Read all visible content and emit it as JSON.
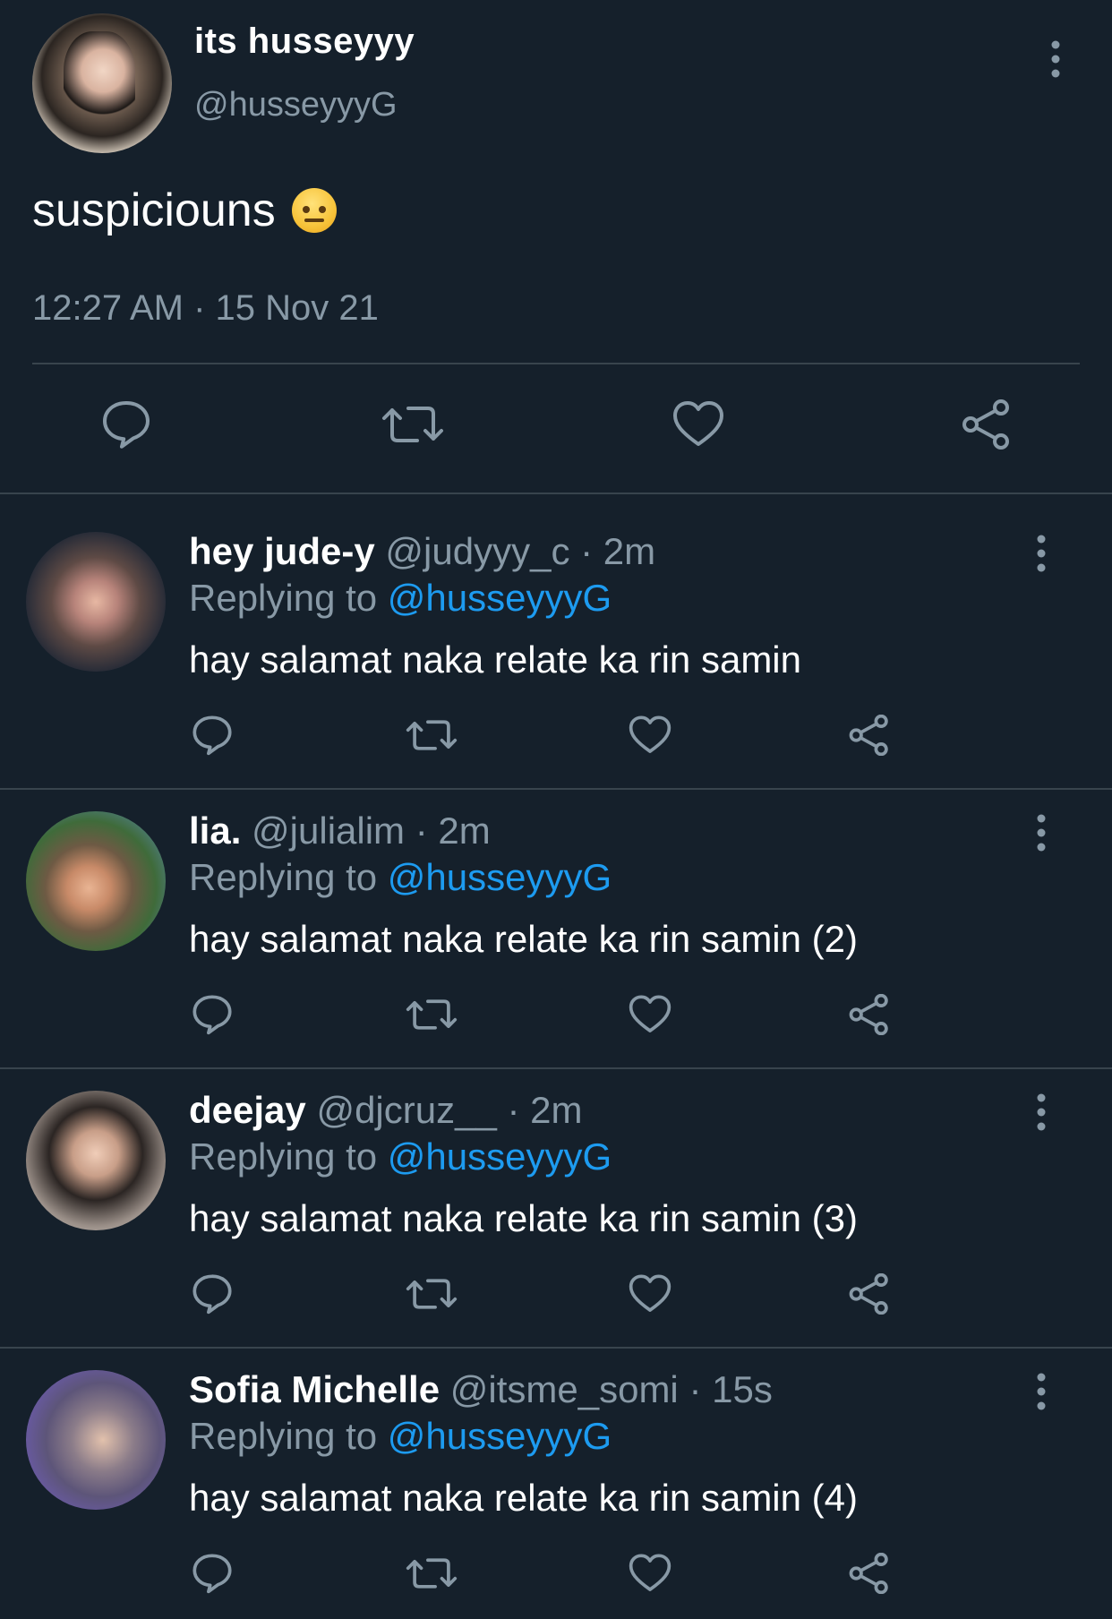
{
  "main": {
    "name": "its husseyyy",
    "handle": "@husseyyyG",
    "text": "suspiciouns",
    "emoji": "face-with-raised-eyebrow",
    "timestamp": "12:27 AM · 15 Nov 21",
    "actions": [
      "reply-icon",
      "retweet-icon",
      "like-icon",
      "share-icon"
    ]
  },
  "replies": [
    {
      "name": "hey jude-y",
      "handle": "@judyyy_c",
      "sep": "·",
      "time": "2m",
      "replying_label": "Replying to",
      "mention": "@husseyyyG",
      "text": "hay salamat naka relate ka rin samin"
    },
    {
      "name": "lia.",
      "handle": "@julialim",
      "sep": "·",
      "time": "2m",
      "replying_label": "Replying to",
      "mention": "@husseyyyG",
      "text": "hay salamat naka relate ka rin samin (2)"
    },
    {
      "name": "deejay",
      "handle": "@djcruz__",
      "sep": "·",
      "time": "2m",
      "replying_label": "Replying to",
      "mention": "@husseyyyG",
      "text": "hay salamat naka relate ka rin samin (3)"
    },
    {
      "name": "Sofia Michelle",
      "handle": "@itsme_somi",
      "sep": "·",
      "time": "15s",
      "replying_label": "Replying to",
      "mention": "@husseyyyG",
      "text": "hay salamat naka relate ka rin samin (4)"
    }
  ],
  "colors": {
    "background": "#15202b",
    "secondary_text": "#8899a6",
    "link": "#1d9bf0",
    "divider": "#38444d"
  }
}
